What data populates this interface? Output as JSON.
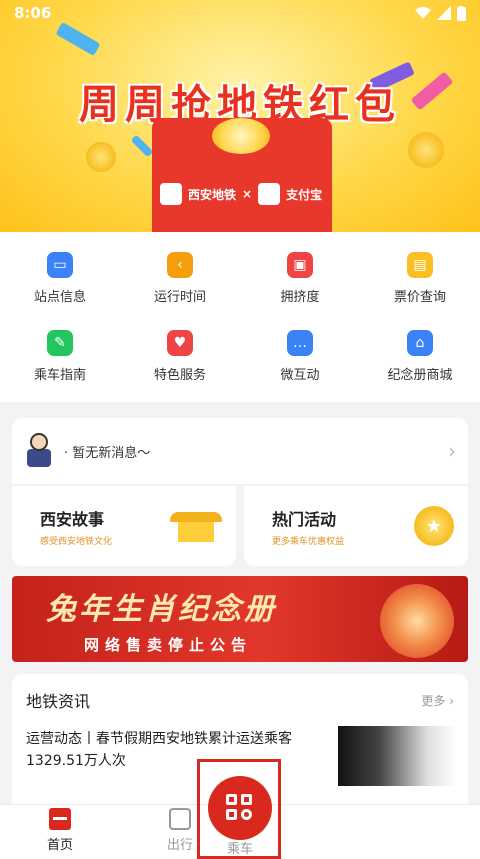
{
  "status_bar": {
    "time": "8:06"
  },
  "banner": {
    "title": "周周抢地铁红包",
    "logo_left": "西安地铁",
    "logo_sep": "×",
    "logo_right": "支付宝",
    "bg_color": "#ffd84a"
  },
  "grid": {
    "items": [
      {
        "label": "站点信息",
        "icon": "info-card-icon",
        "color": "#3b82f6"
      },
      {
        "label": "运行时间",
        "icon": "clock-icon",
        "color": "#f59e0b"
      },
      {
        "label": "拥挤度",
        "icon": "bus-icon",
        "color": "#ef4444"
      },
      {
        "label": "票价查询",
        "icon": "ticket-icon",
        "color": "#fbbf24"
      },
      {
        "label": "乘车指南",
        "icon": "feather-icon",
        "color": "#22c55e"
      },
      {
        "label": "特色服务",
        "icon": "heart-icon",
        "color": "#ef4444"
      },
      {
        "label": "微互动",
        "icon": "chat-icon",
        "color": "#3b82f6"
      },
      {
        "label": "纪念册商城",
        "icon": "shopping-bag-icon",
        "color": "#3b82f6"
      }
    ]
  },
  "notice": {
    "text": "· 暂无新消息〜"
  },
  "cards": {
    "story": {
      "title": "西安故事",
      "subtitle": "感受西安地铁文化"
    },
    "activity": {
      "title": "热门活动",
      "subtitle": "更多乘车优惠权益"
    }
  },
  "promo": {
    "title": "兔年生肖纪念册",
    "subtitle": "网络售卖停止公告"
  },
  "news": {
    "title": "地铁资讯",
    "more": "更多",
    "item": "运营动态丨春节假期西安地铁累计运送乘客1329.51万人次"
  },
  "bottom_nav": {
    "home": "首页",
    "trip": "出行",
    "ride": "乘车",
    "accent": "#d9291e"
  }
}
